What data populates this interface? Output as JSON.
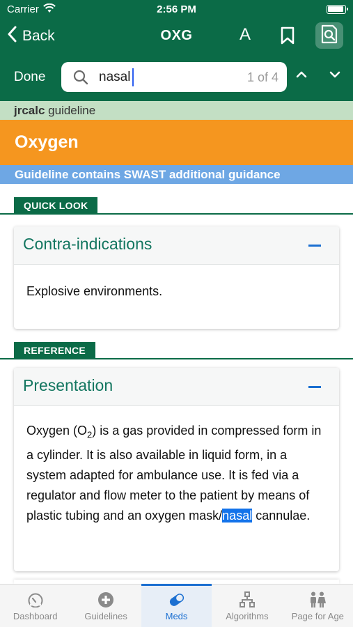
{
  "status_bar": {
    "carrier": "Carrier",
    "time": "2:56 PM"
  },
  "nav": {
    "back_label": "Back",
    "title": "OXG",
    "font_button": "A"
  },
  "search": {
    "done_label": "Done",
    "query": "nasal",
    "result_count": "1 of 4"
  },
  "guideline": {
    "source_brand": "jrcalc",
    "source_suffix": " guideline",
    "title": "Oxygen",
    "notice": "Guideline contains SWAST additional guidance"
  },
  "sections": {
    "quick_look": {
      "tag": "QUICK LOOK",
      "card_title": "Contra-indications",
      "body": "Explosive environments."
    },
    "reference": {
      "tag": "REFERENCE",
      "card_title": "Presentation",
      "body_part1": "Oxygen (O",
      "body_sub": "2",
      "body_part2": ") is a gas provided in compressed form in a cylinder. It is also available in liquid form, in a system adapted for ambulance use. It is fed via a regulator and flow meter to the patient by means of plastic tubing and an oxygen mask/",
      "body_highlight": "nasal",
      "body_part3": " cannulae."
    }
  },
  "tabs": [
    {
      "label": "Dashboard",
      "icon": "dashboard-gauge-icon"
    },
    {
      "label": "Guidelines",
      "icon": "plus-circle-icon"
    },
    {
      "label": "Meds",
      "icon": "pill-icon"
    },
    {
      "label": "Algorithms",
      "icon": "flowchart-icon"
    },
    {
      "label": "Page for Age",
      "icon": "people-icon"
    }
  ],
  "colors": {
    "brand_green": "#0b6b47",
    "oxygen_orange": "#f5961f",
    "notice_blue": "#6ea7e4",
    "active_tab_blue": "#1b6fd1",
    "highlight": "#1373ea"
  }
}
